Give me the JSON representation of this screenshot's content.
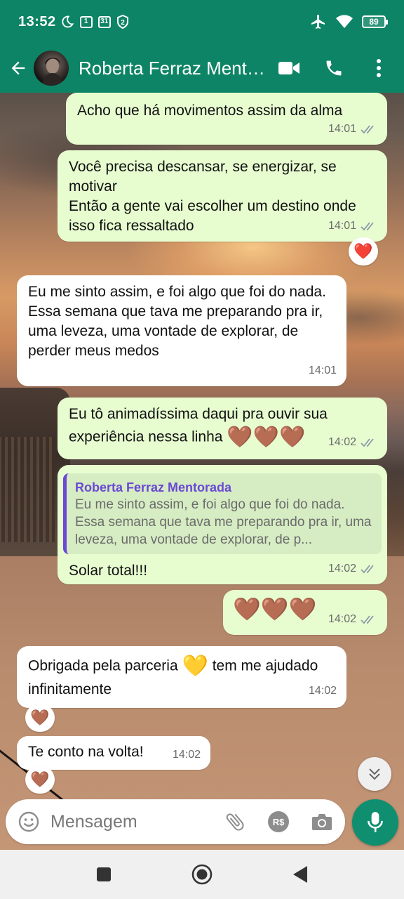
{
  "status_bar": {
    "time": "13:52",
    "icons_left": [
      "moon-icon",
      "sim1-icon",
      "calendar-31-icon",
      "badge-2-icon"
    ],
    "icons_right": [
      "airplane-icon",
      "wifi-icon",
      "battery-icon"
    ],
    "badge_1": "1",
    "calendar_day": "31",
    "badge_2": "2",
    "battery": "89"
  },
  "header": {
    "contact_name": "Roberta Ferraz Mentorada",
    "icons": [
      "back-arrow-icon",
      "avatar",
      "video-call-icon",
      "phone-icon",
      "more-vert-icon"
    ]
  },
  "colors": {
    "header_bg": "#0e8466",
    "outgoing_bubble": "#e7fdd0",
    "incoming_bubble": "#ffffff",
    "quote_accent": "#6a49d4",
    "read_ticks": "#8a9aa8",
    "mic_button": "#0f8e70"
  },
  "messages": [
    {
      "dir": "out",
      "text": "Acho que há movimentos assim da alma",
      "time": "14:01",
      "status": "delivered"
    },
    {
      "dir": "out",
      "text": "Você precisa descansar, se energizar, se motivar\nEntão a gente vai escolher um destino onde isso fica ressaltado",
      "time": "14:01",
      "status": "delivered",
      "reaction": "❤️"
    },
    {
      "dir": "in",
      "text": "Eu me sinto assim, e foi algo que foi do nada. Essa semana que tava me preparando pra ir, uma leveza, uma vontade de explorar, de perder meus medos",
      "time": "14:01"
    },
    {
      "dir": "out",
      "text": "Eu tô animadíssima daqui pra ouvir sua experiência nessa linha",
      "emoji": "🤎🤎🤎",
      "time": "14:02",
      "status": "delivered"
    },
    {
      "dir": "out",
      "quote_name": "Roberta Ferraz Mentorada",
      "quote_text": "Eu me sinto assim, e foi algo que foi do nada. Essa semana que tava me preparando pra ir, uma leveza, uma vontade de explorar, de p...",
      "text": "Solar total!!!",
      "time": "14:02",
      "status": "delivered"
    },
    {
      "dir": "out",
      "emoji": "🤎🤎🤎",
      "time": "14:02",
      "status": "delivered"
    },
    {
      "dir": "in",
      "text_a": "Obrigada pela parceria",
      "emoji": "💛",
      "text_b": "tem me ajudado infinitamente",
      "time": "14:02",
      "reaction": "🤎"
    },
    {
      "dir": "in",
      "text": "Te conto na volta!",
      "time": "14:02",
      "reaction": "🤎"
    }
  ],
  "composer": {
    "placeholder": "Mensagem",
    "rs_label": "R$",
    "icons": [
      "emoji-icon",
      "attach-icon",
      "payment-icon",
      "camera-icon",
      "mic-icon"
    ]
  },
  "navbar": {
    "icons": [
      "recents-icon",
      "home-icon",
      "back-icon"
    ]
  }
}
